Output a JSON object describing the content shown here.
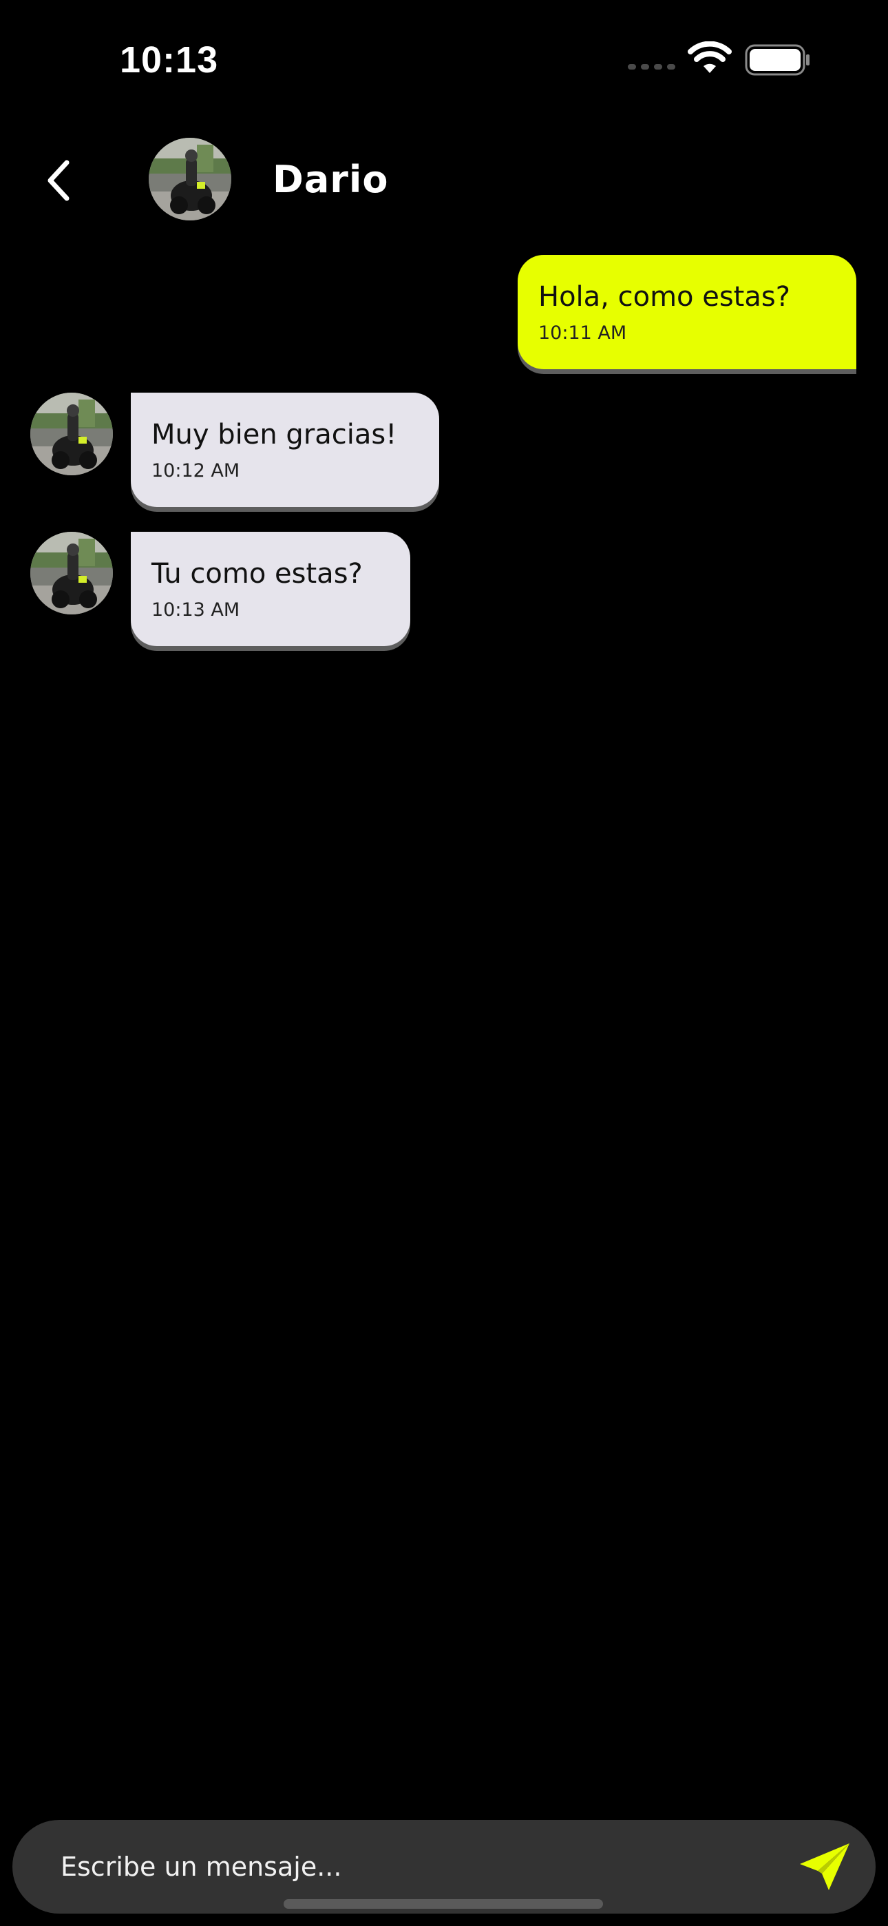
{
  "status_bar": {
    "time": "10:13",
    "icons": [
      "cellular-signal-icon",
      "wifi-icon",
      "battery-icon"
    ]
  },
  "header": {
    "back_icon": "chevron-left-icon",
    "contact_name": "Dario",
    "avatar": "contact-photo-motorcycle"
  },
  "messages": [
    {
      "direction": "outgoing",
      "text": "Hola, como estas?",
      "time": "10:11 AM"
    },
    {
      "direction": "incoming",
      "text": "Muy bien gracias!",
      "time": "10:12 AM"
    },
    {
      "direction": "incoming",
      "text": "Tu como estas?",
      "time": "10:13 AM"
    }
  ],
  "composer": {
    "placeholder": "Escribe un mensaje...",
    "value": "",
    "send_icon": "paper-plane-send-icon"
  },
  "colors": {
    "accent": "#e7ff00",
    "background": "#000000",
    "incoming_bubble": "#e6e4ec",
    "composer_bg": "#333333"
  }
}
